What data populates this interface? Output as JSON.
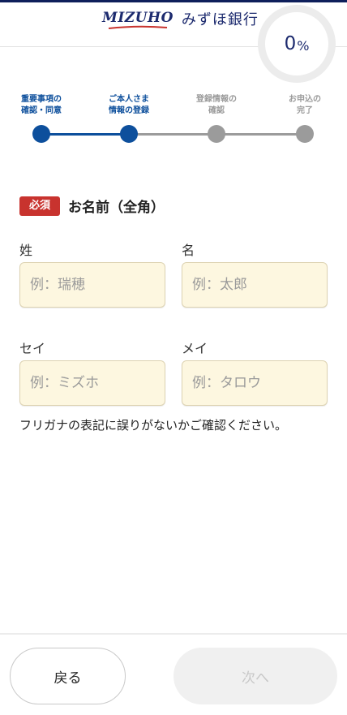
{
  "header": {
    "logo_en": "MIZUHO",
    "logo_ja": "みずほ銀行",
    "progress_value": "0",
    "progress_unit": "%"
  },
  "steps": [
    {
      "label": "重要事項の\n確認・同意",
      "state": "complete"
    },
    {
      "label": "ご本人さま\n情報の登録",
      "state": "current"
    },
    {
      "label": "登録情報の\n確認",
      "state": "pending"
    },
    {
      "label": "お申込の\n完了",
      "state": "pending"
    }
  ],
  "section": {
    "badge": "必須",
    "title": "お名前（全角）"
  },
  "fields": {
    "last_name": {
      "label": "姓",
      "placeholder": "例：瑞穂",
      "value": ""
    },
    "first_name": {
      "label": "名",
      "placeholder": "例：太郎",
      "value": ""
    },
    "last_name_kana": {
      "label": "セイ",
      "placeholder": "例：ミズホ",
      "value": ""
    },
    "first_name_kana": {
      "label": "メイ",
      "placeholder": "例：タロウ",
      "value": ""
    }
  },
  "note": "フリガナの表記に誤りがないかご確認ください。",
  "buttons": {
    "back": "戻る",
    "next": "次へ"
  },
  "colors": {
    "brand_navy": "#1c2a6e",
    "step_active": "#0d4f9c",
    "step_inactive": "#9b9b9b",
    "required_red": "#c8332e",
    "input_bg": "#fdf7e0"
  }
}
